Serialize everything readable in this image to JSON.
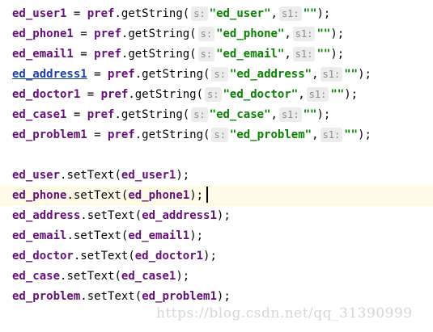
{
  "code": {
    "getstring_lines": [
      {
        "var": "ed_user1",
        "pref": "pref",
        "method": "getString",
        "hint_s": "s:",
        "key": "\"ed_user\"",
        "hint_s1": "s1:",
        "default": "\"\""
      },
      {
        "var": "ed_phone1",
        "pref": "pref",
        "method": "getString",
        "hint_s": "s:",
        "key": "\"ed_phone\"",
        "hint_s1": "s1:",
        "default": "\"\""
      },
      {
        "var": "ed_email1",
        "pref": "pref",
        "method": "getString",
        "hint_s": "s:",
        "key": "\"ed_email\"",
        "hint_s1": "s1:",
        "default": "\"\""
      },
      {
        "var": "ed_address1",
        "pref": "pref",
        "method": "getString",
        "hint_s": "s:",
        "key": "\"ed_address\"",
        "hint_s1": "s1:",
        "default": "\"\""
      },
      {
        "var": "ed_doctor1",
        "pref": "pref",
        "method": "getString",
        "hint_s": "s:",
        "key": "\"ed_doctor\"",
        "hint_s1": "s1:",
        "default": "\"\""
      },
      {
        "var": "ed_case1",
        "pref": "pref",
        "method": "getString",
        "hint_s": "s:",
        "key": "\"ed_case\"",
        "hint_s1": "s1:",
        "default": "\"\""
      },
      {
        "var": "ed_problem1",
        "pref": "pref",
        "method": "getString",
        "hint_s": "s:",
        "key": "\"ed_problem\"",
        "hint_s1": "s1:",
        "default": "\"\""
      }
    ],
    "settext_lines": [
      {
        "target": "ed_user",
        "method": "setText",
        "arg": "ed_user1"
      },
      {
        "target": "ed_phone",
        "method": "setText",
        "arg": "ed_phone1"
      },
      {
        "target": "ed_address",
        "method": "setText",
        "arg": "ed_address1"
      },
      {
        "target": "ed_email",
        "method": "setText",
        "arg": "ed_email1"
      },
      {
        "target": "ed_doctor",
        "method": "setText",
        "arg": "ed_doctor1"
      },
      {
        "target": "ed_case",
        "method": "setText",
        "arg": "ed_case1"
      },
      {
        "target": "ed_problem",
        "method": "setText",
        "arg": "ed_problem1"
      }
    ]
  },
  "watermark": "https://blog.csdn.net/qq_31390999",
  "colors": {
    "variable": "#660e7a",
    "string": "#088000",
    "hint_bg": "#ececec",
    "current_line": "#fffbe8"
  }
}
